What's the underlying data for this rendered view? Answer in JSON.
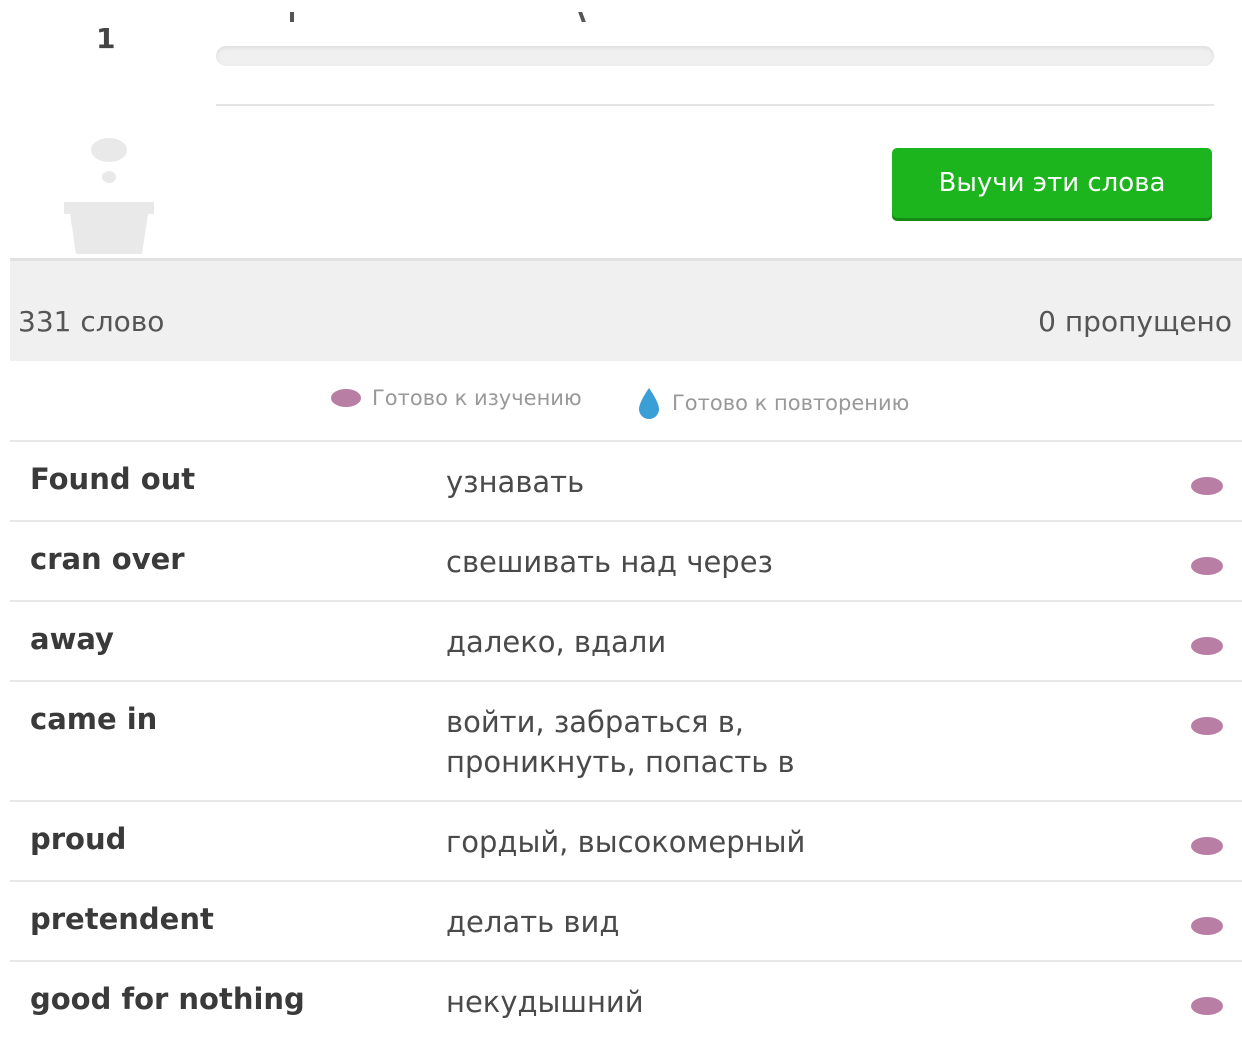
{
  "header": {
    "level_number": "1"
  },
  "actions": {
    "learn_button_label": "Выучи эти слова"
  },
  "stats": {
    "word_count": "331 слово",
    "skipped_count": "0 пропущено"
  },
  "legend": {
    "ready_to_learn": "Готово к изучению",
    "ready_to_review": "Готово к повторению"
  },
  "colors": {
    "seed": "#b97ea3",
    "water": "#3a9fd6",
    "button": "#1db51d"
  },
  "icons": {
    "plant": "plant-pot-icon",
    "seed": "seed-icon",
    "water": "water-drop-icon"
  },
  "words": [
    {
      "term": "Found out",
      "definition": "узнавать"
    },
    {
      "term": "cran over",
      "definition": "свешивать над через"
    },
    {
      "term": "away",
      "definition": "далеко, вдали"
    },
    {
      "term": "came in",
      "definition": "войти, забраться в, проникнуть, попасть в"
    },
    {
      "term": "proud",
      "definition": "гордый, высокомерный"
    },
    {
      "term": "pretendent",
      "definition": "делать вид"
    },
    {
      "term": "good for nothing",
      "definition": "некудышний"
    }
  ]
}
